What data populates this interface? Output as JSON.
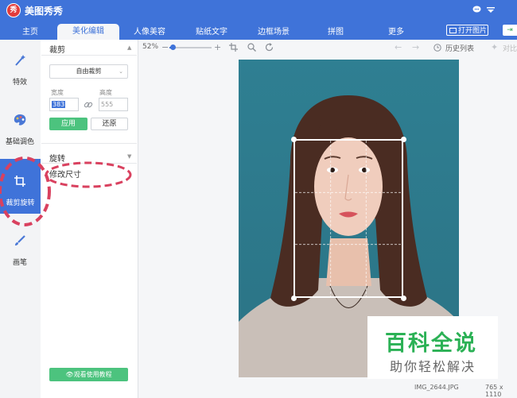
{
  "titlebar": {
    "app_name": "美图秀秀",
    "logo_char": "秀",
    "icons": [
      "chat-icon",
      "menu-icon"
    ]
  },
  "nav": {
    "tabs": [
      "主页",
      "美化编辑",
      "人像美容",
      "贴纸文字",
      "边框场景",
      "拼图",
      "更多"
    ],
    "active_tab": "美化编辑",
    "open_image": "打开图片",
    "accent": "#3f73d9"
  },
  "sidebar": {
    "items": [
      {
        "label": "特效",
        "icon": "magic-wand-icon"
      },
      {
        "label": "基础调色",
        "icon": "palette-icon"
      },
      {
        "label": "裁剪旋转",
        "icon": "crop-icon"
      },
      {
        "label": "画笔",
        "icon": "brush-icon"
      }
    ],
    "active": "裁剪旋转"
  },
  "panel": {
    "crop": {
      "title": "裁剪",
      "mode": "自由裁剪",
      "width_label": "宽度",
      "height_label": "高度",
      "width_value": "383",
      "height_value": "555",
      "apply": "应用",
      "restore": "还原"
    },
    "rotate": {
      "title": "旋转",
      "resize": "修改尺寸"
    },
    "tutorial": "观看使用教程"
  },
  "toolbar": {
    "zoom": "52%",
    "history": "历史列表",
    "compare": "对比"
  },
  "footer": {
    "file_name": "IMG_2644.JPG",
    "dimensions": "765 x 1110"
  },
  "watermark": {
    "title": "百科全说",
    "subtitle": "助你轻松解决"
  },
  "colors": {
    "accent": "#3f73d9",
    "green": "#4cc37e",
    "annotation": "#d9415f"
  }
}
